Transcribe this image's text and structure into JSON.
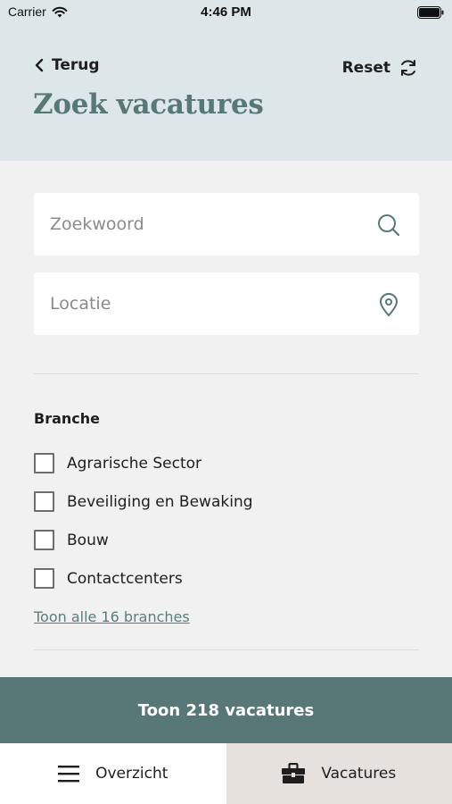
{
  "status_bar": {
    "carrier": "Carrier",
    "time": "4:46 PM"
  },
  "header": {
    "back_label": "Terug",
    "reset_label": "Reset",
    "title": "Zoek vacatures"
  },
  "search": {
    "keyword": {
      "placeholder": "Zoekwoord",
      "value": "",
      "icon": "search-icon"
    },
    "location": {
      "placeholder": "Locatie",
      "value": "",
      "icon": "location-pin-icon"
    }
  },
  "branche": {
    "title": "Branche",
    "items": [
      {
        "label": "Agrarische Sector",
        "checked": false
      },
      {
        "label": "Beveiliging en Bewaking",
        "checked": false
      },
      {
        "label": "Bouw",
        "checked": false
      },
      {
        "label": "Contactcenters",
        "checked": false
      }
    ],
    "more_link": "Toon alle 16 branches"
  },
  "cta": {
    "label": "Toon 218 vacatures"
  },
  "tabbar": {
    "tabs": [
      {
        "label": "Overzicht",
        "icon": "menu-icon",
        "active": false
      },
      {
        "label": "Vacatures",
        "icon": "briefcase-icon",
        "active": true
      }
    ]
  },
  "colors": {
    "accent": "#587878",
    "header_bg": "#dde6e8",
    "page_bg": "#f1f1f1",
    "tab_active_bg": "#e6e1dd"
  }
}
